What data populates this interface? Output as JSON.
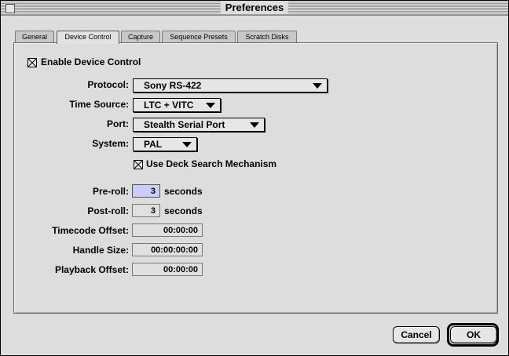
{
  "window": {
    "title": "Preferences"
  },
  "tabs": [
    {
      "label": "General",
      "active": false
    },
    {
      "label": "Device Control",
      "active": true
    },
    {
      "label": "Capture",
      "active": false
    },
    {
      "label": "Sequence Presets",
      "active": false
    },
    {
      "label": "Scratch Disks",
      "active": false
    }
  ],
  "device_control": {
    "enable_label": "Enable Device Control",
    "enable_checked": true,
    "protocol_label": "Protocol:",
    "protocol_value": "Sony RS-422",
    "time_source_label": "Time Source:",
    "time_source_value": "LTC + VITC",
    "port_label": "Port:",
    "port_value": "Stealth Serial Port",
    "system_label": "System:",
    "system_value": "PAL",
    "deck_search_label": "Use Deck Search Mechanism",
    "deck_search_checked": true,
    "preroll_label": "Pre-roll:",
    "preroll_value": "3",
    "postroll_label": "Post-roll:",
    "postroll_value": "3",
    "seconds_unit": "seconds",
    "timecode_offset_label": "Timecode Offset:",
    "timecode_offset_value": "00:00:00",
    "handle_size_label": "Handle Size:",
    "handle_size_value": "00:00:00:00",
    "playback_offset_label": "Playback Offset:",
    "playback_offset_value": "00:00:00"
  },
  "buttons": {
    "cancel": "Cancel",
    "ok": "OK"
  }
}
